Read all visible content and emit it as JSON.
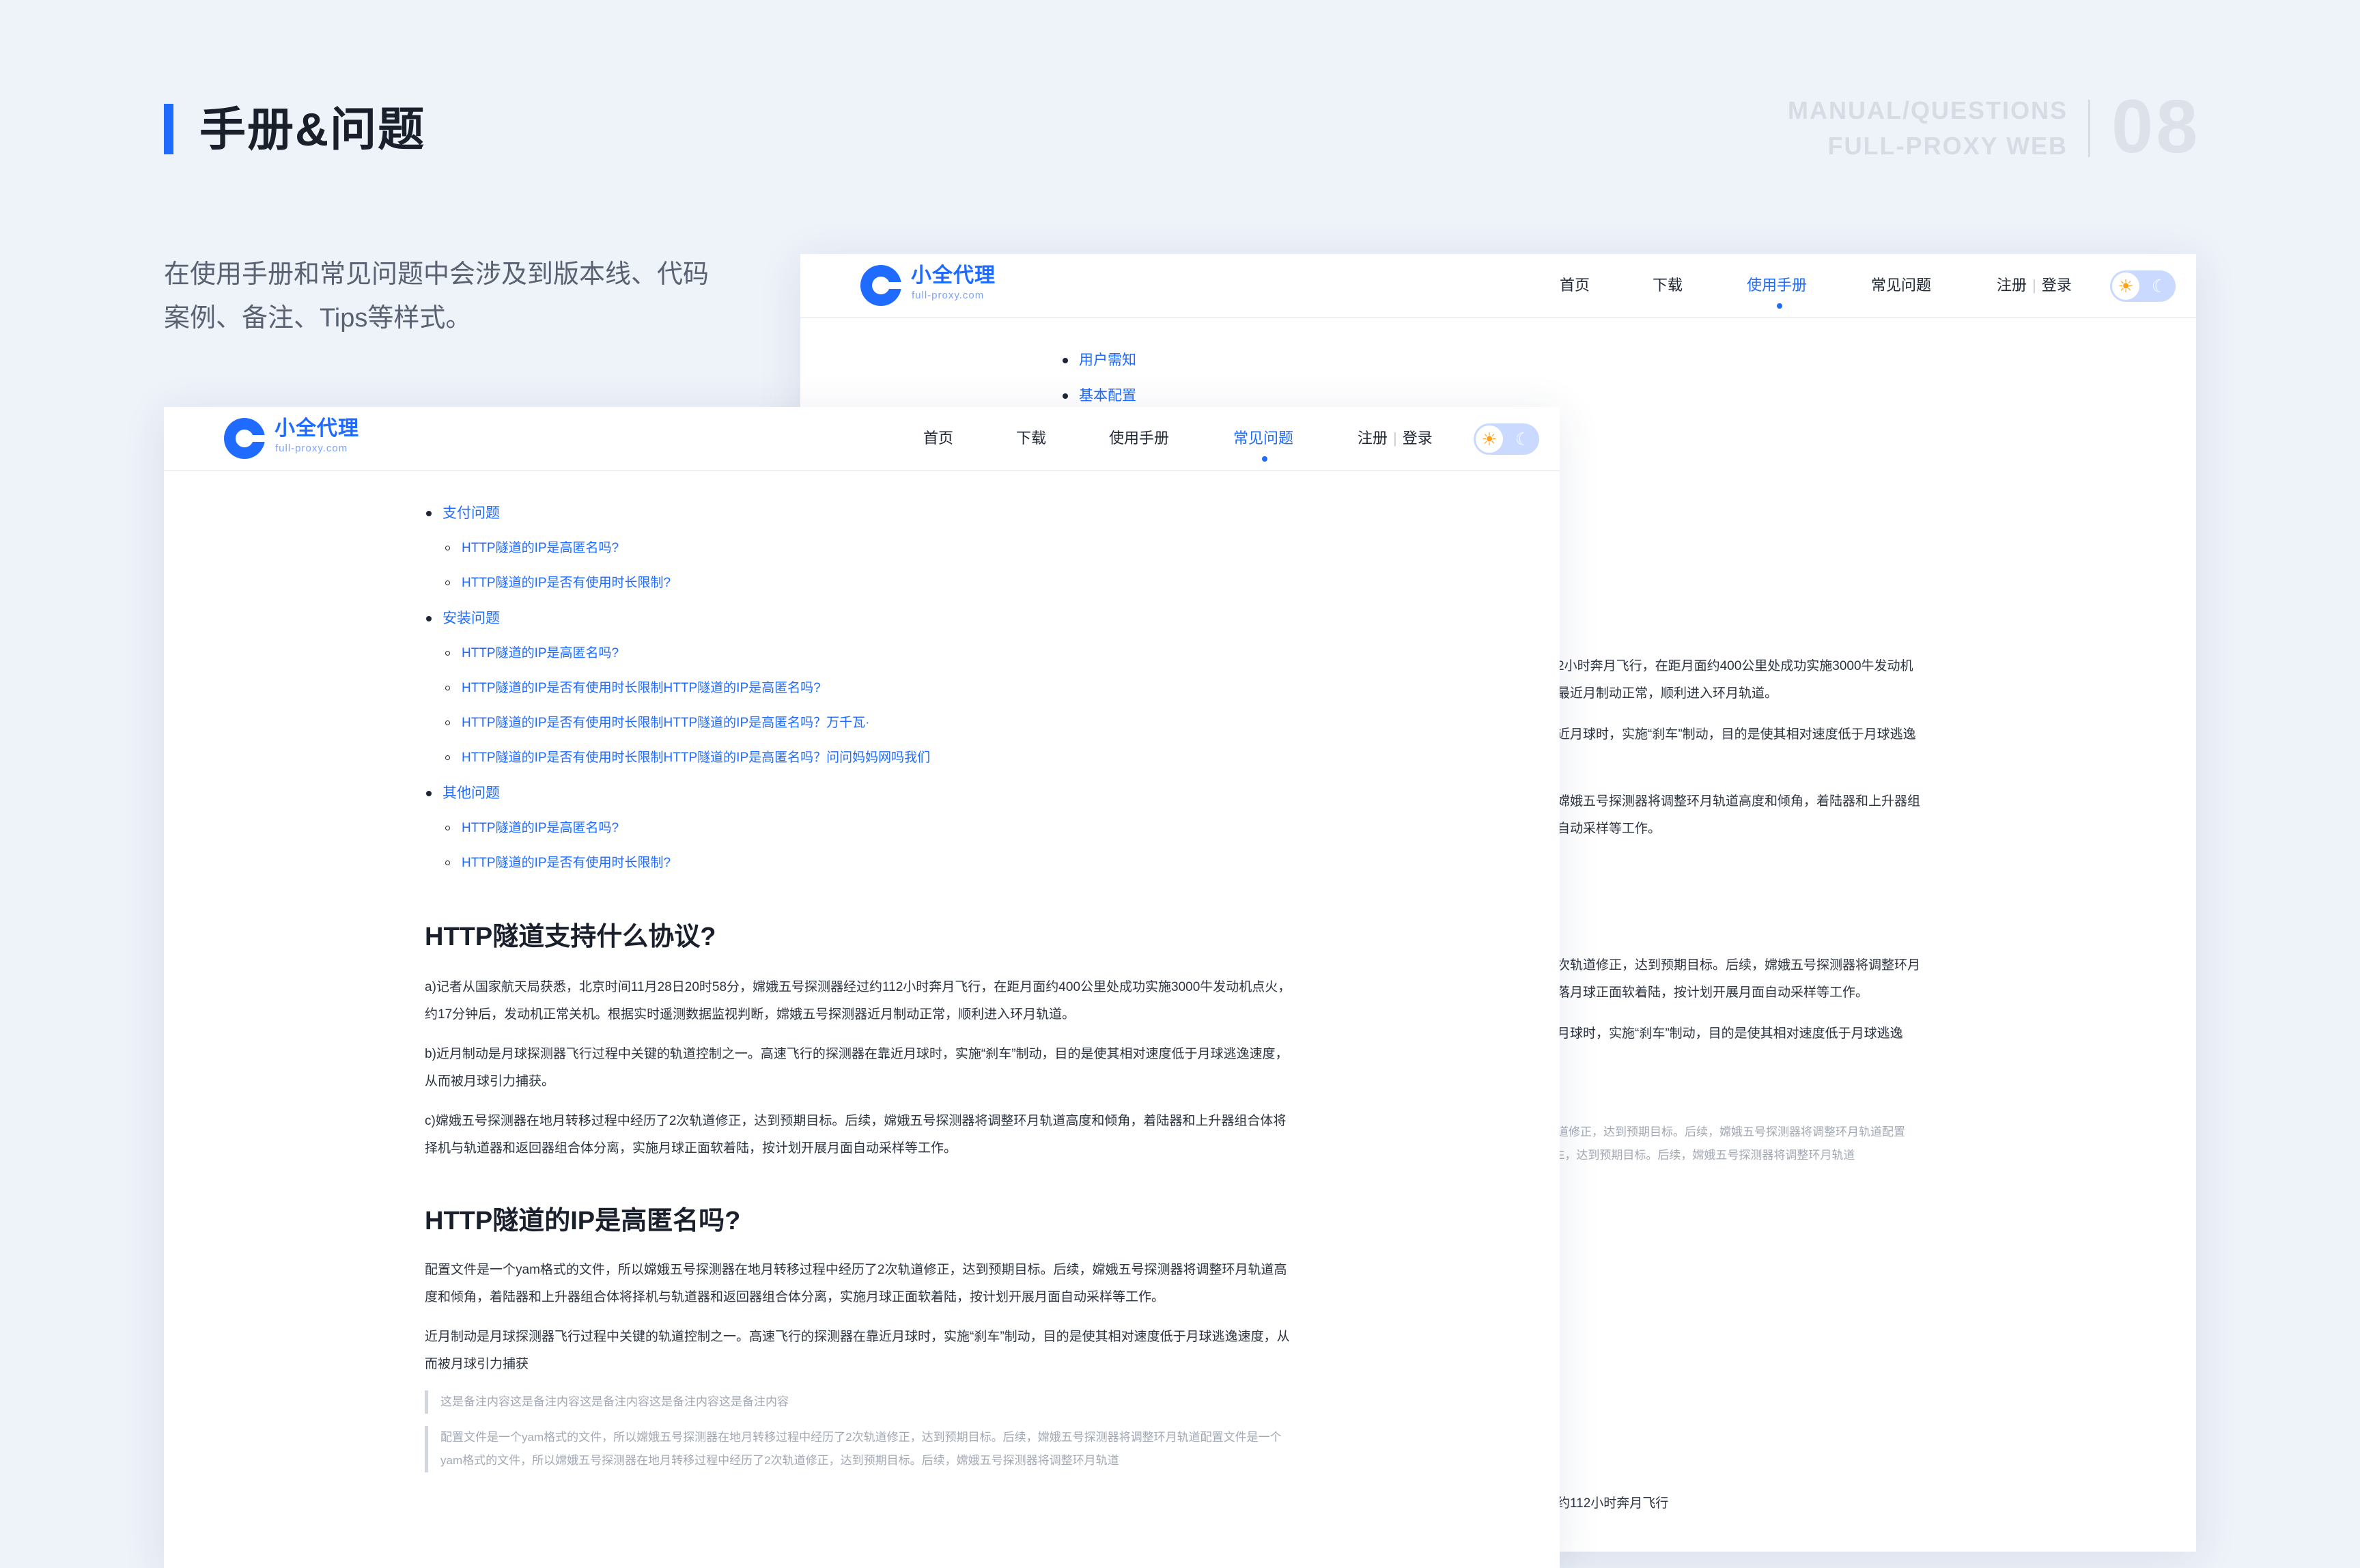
{
  "header": {
    "title": "手册&问题",
    "code_line1": "MANUAL/QUESTIONS",
    "code_line2": "FULL-PROXY WEB",
    "number": "08",
    "accent": "#1f6bff"
  },
  "intro": "在使用手册和常见问题中会涉及到版本线、代码案例、备注、Tips等样式。",
  "brand": {
    "name": "小全代理",
    "domain": "full-proxy.com"
  },
  "nav": {
    "home": "首页",
    "download": "下载",
    "manual": "使用手册",
    "faq": "常见问题",
    "register": "注册",
    "separator": "|",
    "login": "登录"
  },
  "back_card": {
    "toc": [
      "用户需知",
      "基本配置"
    ],
    "lines": [
      "2小时奔月飞行，在距月面约400公里处成功实施3000牛发动机",
      "最近月制动正常，顺利进入环月轨道。",
      "近月球时，实施“刹车”制动，目的是使其相对速度低于月球逃逸",
      "嫦娥五号探测器将调整环月轨道高度和倾角，着陆器和上升器组",
      "自动采样等工作。",
      "次轨道修正，达到预期目标。后续，嫦娥五号探测器将调整环月",
      "落月球正面软着陆，按计划开展月面自动采样等工作。",
      "月球时，实施“刹车”制动，目的是使其相对速度低于月球逃逸",
      "道修正，达到预期目标。后续，嫦娥五号探测器将调整环月轨道配置",
      "E，达到预期目标。后续，嫦娥五号探测器将调整环月轨道",
      "约112小时奔月飞行"
    ]
  },
  "toc": {
    "sections": [
      {
        "title": "支付问题",
        "items": [
          "HTTP隧道的IP是高匿名吗?",
          "HTTP隧道的IP是否有使用时长限制?"
        ]
      },
      {
        "title": "安装问题",
        "items": [
          "HTTP隧道的IP是高匿名吗?",
          "HTTP隧道的IP是否有使用时长限制HTTP隧道的IP是高匿名吗?",
          "HTTP隧道的IP是否有使用时长限制HTTP隧道的IP是高匿名吗？万千瓦·",
          "HTTP隧道的IP是否有使用时长限制HTTP隧道的IP是高匿名吗？问问妈妈网吗我们"
        ]
      },
      {
        "title": "其他问题",
        "items": [
          "HTTP隧道的IP是高匿名吗?",
          "HTTP隧道的IP是否有使用时长限制?"
        ]
      }
    ]
  },
  "article": {
    "h1": "HTTP隧道支持什么协议?",
    "p1": "a)记者从国家航天局获悉，北京时间11月28日20时58分，嫦娥五号探测器经过约112小时奔月飞行，在距月面约400公里处成功实施3000牛发动机点火，约17分钟后，发动机正常关机。根据实时遥测数据监视判断，嫦娥五号探测器近月制动正常，顺利进入环月轨道。",
    "p2": "b)近月制动是月球探测器飞行过程中关键的轨道控制之一。高速飞行的探测器在靠近月球时，实施“刹车”制动，目的是使其相对速度低于月球逃逸速度，从而被月球引力捕获。",
    "p3": "c)嫦娥五号探测器在地月转移过程中经历了2次轨道修正，达到预期目标。后续，嫦娥五号探测器将调整环月轨道高度和倾角，着陆器和上升器组合体将择机与轨道器和返回器组合体分离，实施月球正面软着陆，按计划开展月面自动采样等工作。",
    "h2": "HTTP隧道的IP是高匿名吗?",
    "p4": "配置文件是一个yam格式的文件，所以嫦娥五号探测器在地月转移过程中经历了2次轨道修正，达到预期目标。后续，嫦娥五号探测器将调整环月轨道高度和倾角，着陆器和上升器组合体将择机与轨道器和返回器组合体分离，实施月球正面软着陆，按计划开展月面自动采样等工作。",
    "p5": "近月制动是月球探测器飞行过程中关键的轨道控制之一。高速飞行的探测器在靠近月球时，实施“刹车”制动，目的是使其相对速度低于月球逃逸速度，从而被月球引力捕获",
    "note1": "这是备注内容这是备注内容这是备注内容这是备注内容这是备注内容",
    "note2": "配置文件是一个yam格式的文件，所以嫦娥五号探测器在地月转移过程中经历了2次轨道修正，达到预期目标。后续，嫦娥五号探测器将调整环月轨道配置文件是一个yam格式的文件，所以嫦娥五号探测器在地月转移过程中经历了2次轨道修正，达到预期目标。后续，嫦娥五号探测器将调整环月轨道"
  }
}
